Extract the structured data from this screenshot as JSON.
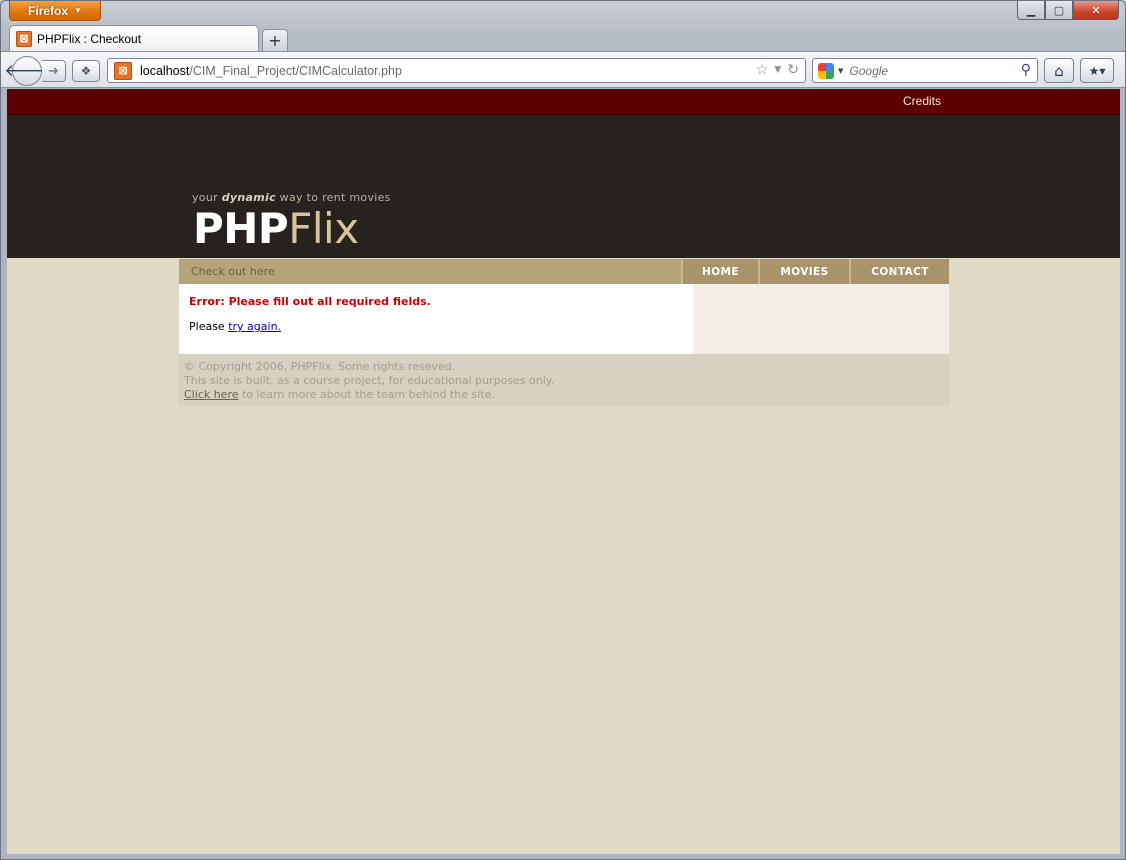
{
  "browser": {
    "app_button": "Firefox",
    "window_controls": {
      "minimize": "▁",
      "maximize": "▢",
      "close": "✕"
    },
    "tab": {
      "title": "PHPFlix : Checkout"
    },
    "new_tab": "+",
    "url": {
      "host": "localhost",
      "path": "/CIM_Final_Project/CIMCalculator.php"
    },
    "search": {
      "placeholder": "Google"
    }
  },
  "page": {
    "top_link": "Credits",
    "tagline": {
      "prefix": "your ",
      "emphasis": "dynamic",
      "suffix": " way to rent movies"
    },
    "logo": {
      "part1": "PHP",
      "part2": "Flix"
    },
    "breadcrumb": "Check out here",
    "nav": [
      {
        "label": "HOME"
      },
      {
        "label": "MOVIES"
      },
      {
        "label": "CONTACT"
      }
    ],
    "error_message": "Error: Please fill out all required fields.",
    "retry": {
      "prefix": "Please ",
      "link": "try again."
    },
    "footer": {
      "copyright": "© Copyright 2006, PHPFlix. Some rights reseved.",
      "note": "This site is built, as a course project, for educational purposes only.",
      "link": "Click here",
      "link_suffix": " to learn more about the team behind the site."
    }
  },
  "colors": {
    "top_strip": "#5d0000",
    "header": "#27221d",
    "menu_bar": "#b5a37a",
    "page_bg": "#e0d9c6",
    "error": "#cc0000"
  }
}
